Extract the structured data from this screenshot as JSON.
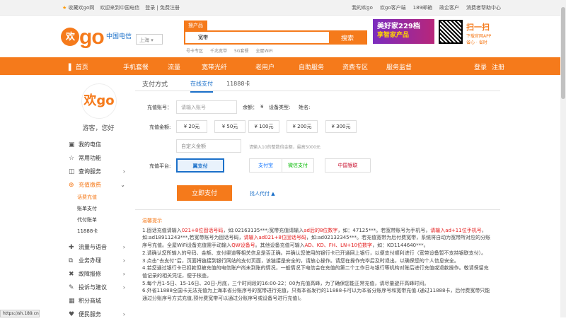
{
  "topbar": {
    "fav": "收藏欢go网",
    "welcome": "欢迎来到中国电信",
    "login": "登录 | 免费注册",
    "mine": "我的欢go",
    "client": "欢go客户端",
    "mail": "189邮箱",
    "ent": "政企客户",
    "help": "消费者帮助中心"
  },
  "header": {
    "logo_text": "go",
    "logo_circle": "欢",
    "carrier": "中国电信",
    "city": "上海",
    "search_tab": "搜产品",
    "search_value": "宽带",
    "search_btn": "搜索",
    "hot": [
      "号卡专区",
      "千兆宽带",
      "5G套餐",
      "全屋WiFi"
    ],
    "ad_line1": "美好家229档",
    "ad_line2": "享智家产品",
    "scan_title": "扫一扫",
    "scan_sub1": "下载官网APP",
    "scan_sub2": "省心 · 省时"
  },
  "nav": {
    "items": [
      "首页",
      "手机套餐",
      "流量",
      "宽带光纤",
      "老用户",
      "自助服务",
      "资费专区",
      "服务监督"
    ],
    "login": "登录",
    "register": "注册"
  },
  "sidebar": {
    "logo": "欢go",
    "guest": "游客，您好",
    "items": [
      {
        "icon": "▣",
        "label": "我的电信"
      },
      {
        "icon": "☆",
        "label": "常用功能"
      },
      {
        "icon": "◫",
        "label": "查询服务"
      },
      {
        "icon": "⊕",
        "label": "充值缴费"
      }
    ],
    "subs": [
      "话费充值",
      "账单支付",
      "代付账单",
      "11888卡"
    ],
    "items2": [
      {
        "icon": "✚",
        "label": "流量与语音"
      },
      {
        "icon": "⧉",
        "label": "业务办理"
      },
      {
        "icon": "✖",
        "label": "故障报修"
      },
      {
        "icon": "✎",
        "label": "投诉与建议"
      },
      {
        "icon": "▦",
        "label": "积分商城"
      },
      {
        "icon": "♥",
        "label": "便民服务"
      }
    ]
  },
  "main": {
    "tab_title": "支付方式",
    "tab1": "在线支付",
    "tab2": "11888卡",
    "account_label": "充值账号：",
    "account_placeholder": "请输入账号",
    "balance_label": "余额：",
    "balance_unit": "¥",
    "device_label": "设备类型:",
    "name_label": "姓名:",
    "amount_label": "充值金额:",
    "amounts": [
      "¥ 20元",
      "¥ 50元",
      "¥ 100元",
      "¥ 200元",
      "¥ 300元"
    ],
    "custom_placeholder": "自定义金额",
    "custom_hint": "请输入10的整数倍金额，最高5000元",
    "platform_label": "充值平台:",
    "platforms": [
      "翼支付",
      "支付宝",
      "微信支付",
      "中国银联"
    ],
    "pay_button": "立即支付",
    "agent": "找人代付"
  },
  "tips": {
    "title": "温馨提示",
    "l1a": "1.固话充值请输入",
    "l1b": "021+8位固话号码",
    "l1c": "，如:02163135***;宽带充值请输入",
    "l1d": "ad后的8位数字",
    "l1e": "，如：47125***。若宽带账号为手机号，",
    "l1f": "请输入ad+11位手机号",
    "l1g": "，如:ad18911243***,若宽带账号为固话号码，",
    "l1h": "请输入ad021+8位固话号码",
    "l1i": "，如:ad02132345***。若充值宽带为后付费宽带，系统将自动为宽带所对应的分账序号充值。全屋WiFi设备充值需手动输入",
    "l1j": "QW设备号",
    "l1k": "。其他设备充值可输入",
    "l1l": "AD、KD、FH、LN+10位数字",
    "l1m": "，如：KD1144640***。",
    "l2": "2.请确认您所输入的号码、金额、支付渠道等相关信息是否正确。并确认您使用的银行卡已开通网上银行，以便支付顺利进行（宽带设备暂不支持银联支付）。",
    "l3": "3.点击“去支付”后，页面将链接到银行网站的支付页面，该链接是安全的，请放心操作。请您在操作完毕后及时退出，以确保您的个人信息安全。",
    "l4": "4.若您通过银行卡已扣款但被充值的电信账户尚未到账的情况，一般情况下电信会在充值的第二个工作日与银行等机构对账后进行充值或退款操作。敬请保留充值记录的相关凭证，便于核查。",
    "l5": "5.每个月1-5日、15-16日、20日-月底，三个时间段的16:00-22：00为充值高峰，为了确保您能正常充值，请尽量避开高峰时间。",
    "l6": "6.外省11888全国卡无法充值为上海本省分账序号的宽带进行充值，只有本省发行的11888卡可以为本省分账序号和宽带充值.(通过11888卡，后付费宽带只能通过分账序号方式充值,预付费宽带可以通过分账序号或设备号进行充值)。"
  },
  "status": "https://sh.189.cn"
}
